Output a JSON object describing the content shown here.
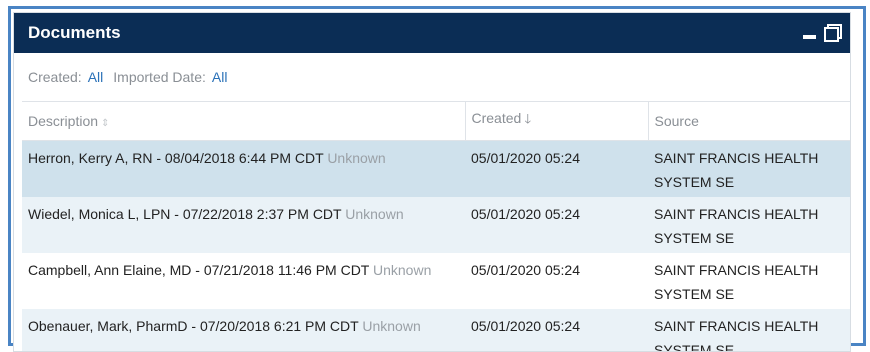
{
  "panel": {
    "title": "Documents"
  },
  "filters": {
    "created_label": "Created:",
    "created_value": "All",
    "imported_label": "Imported Date:",
    "imported_value": "All"
  },
  "table": {
    "columns": [
      "Description",
      "Created",
      "Source"
    ],
    "sort_column": "Created",
    "sort_direction": "descending",
    "rows": [
      {
        "description": "Herron, Kerry A, RN - 08/04/2018 6:44 PM CDT",
        "status": "Unknown",
        "created": "05/01/2020 05:24",
        "source": "SAINT FRANCIS HEALTH SYSTEM SE"
      },
      {
        "description": "Wiedel, Monica L, LPN - 07/22/2018 2:37 PM CDT",
        "status": "Unknown",
        "created": "05/01/2020 05:24",
        "source": "SAINT FRANCIS HEALTH SYSTEM SE"
      },
      {
        "description": "Campbell, Ann Elaine, MD - 07/21/2018 11:46 PM CDT",
        "status": "Unknown",
        "created": "05/01/2020 05:24",
        "source": "SAINT FRANCIS HEALTH SYSTEM SE"
      },
      {
        "description": "Obenauer, Mark, PharmD - 07/20/2018 6:21 PM CDT",
        "status": "Unknown",
        "created": "05/01/2020 05:24",
        "source": "SAINT FRANCIS HEALTH SYSTEM SE"
      }
    ]
  },
  "colors": {
    "titlebar": "#0b2d55",
    "link": "#2a71b8",
    "selected_row": "#cfe1ec",
    "alt_row": "#eaf2f7",
    "frame": "#4a84c4"
  },
  "icons": {
    "minimize": "minimize-icon",
    "restore": "restore-window-icon",
    "sort_unsorted": "sort-icon",
    "sort_desc": "arrow-down-icon"
  }
}
